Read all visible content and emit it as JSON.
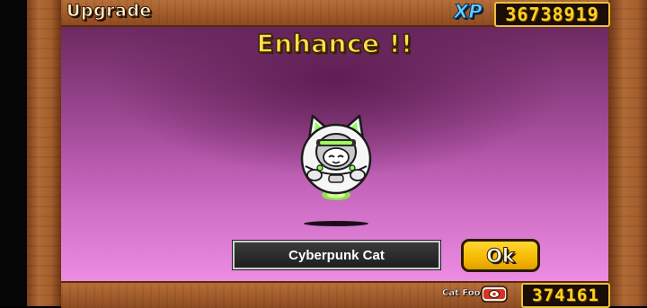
{
  "header": {
    "title": "Upgrade",
    "xp_label": "XP",
    "xp_value": "36738919"
  },
  "main": {
    "headline": "Enhance !!",
    "unit_name": "Cyberpunk Cat",
    "ok_label": "Ok",
    "unit_icon": "cyberpunk-cat-sprite"
  },
  "footer": {
    "cat_food_label": "Cat Food",
    "cat_food_icon": "cat-food-can-icon",
    "cat_food_value": "374161"
  },
  "colors": {
    "accent_gold": "#ffd21f",
    "xp_blue": "#5fd0ff",
    "stage_top": "#6b2a60",
    "stage_bottom": "#ec8ce2",
    "wood": "#a35d2c"
  }
}
